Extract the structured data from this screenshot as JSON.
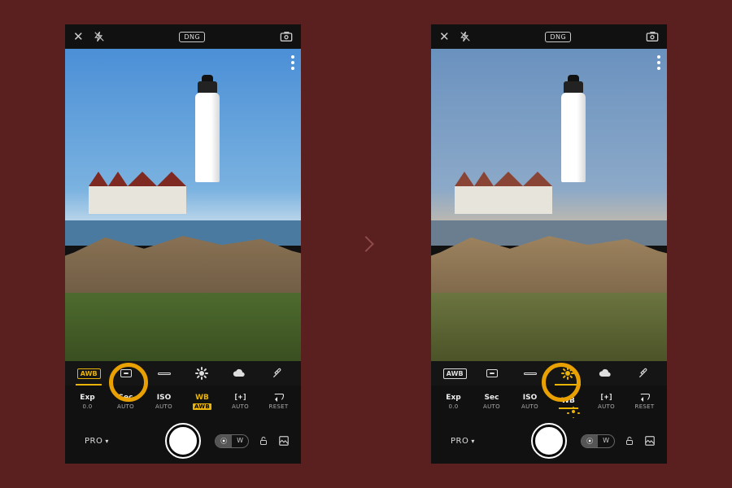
{
  "comparison": {
    "direction": "before-after"
  },
  "topbar": {
    "format_badge": "DNG"
  },
  "wb_options": [
    {
      "id": "awb",
      "name": "auto-white-balance",
      "label": "AWB"
    },
    {
      "id": "tungsten",
      "name": "tungsten"
    },
    {
      "id": "fluorescent",
      "name": "fluorescent"
    },
    {
      "id": "daylight",
      "name": "daylight"
    },
    {
      "id": "cloudy",
      "name": "cloudy"
    },
    {
      "id": "custom",
      "name": "custom-eyedropper"
    }
  ],
  "left": {
    "wb_selected": "awb",
    "controls": [
      {
        "id": "exp",
        "label": "Exp",
        "value": "0.0"
      },
      {
        "id": "sec",
        "label": "Sec",
        "value": "AUTO"
      },
      {
        "id": "iso",
        "label": "ISO",
        "value": "AUTO"
      },
      {
        "id": "wb",
        "label": "WB",
        "value": "AWB",
        "active": true
      },
      {
        "id": "bracket",
        "label": "[+]",
        "value": "AUTO"
      },
      {
        "id": "reset",
        "label": "",
        "value": "RESET"
      }
    ],
    "highlight_target": "wb-option-awb"
  },
  "right": {
    "wb_selected": "daylight",
    "controls": [
      {
        "id": "exp",
        "label": "Exp",
        "value": "0.0"
      },
      {
        "id": "sec",
        "label": "Sec",
        "value": "AUTO"
      },
      {
        "id": "iso",
        "label": "ISO",
        "value": "AUTO"
      },
      {
        "id": "wb",
        "label": "WB",
        "value": "",
        "active": true,
        "icon": "sun"
      },
      {
        "id": "bracket",
        "label": "[+]",
        "value": "AUTO"
      },
      {
        "id": "reset",
        "label": "",
        "value": "RESET"
      }
    ],
    "highlight_target": "wb-option-daylight"
  },
  "bottombar": {
    "mode_label": "PRO",
    "wide_toggle": {
      "on": "⦿",
      "off": "W"
    }
  }
}
